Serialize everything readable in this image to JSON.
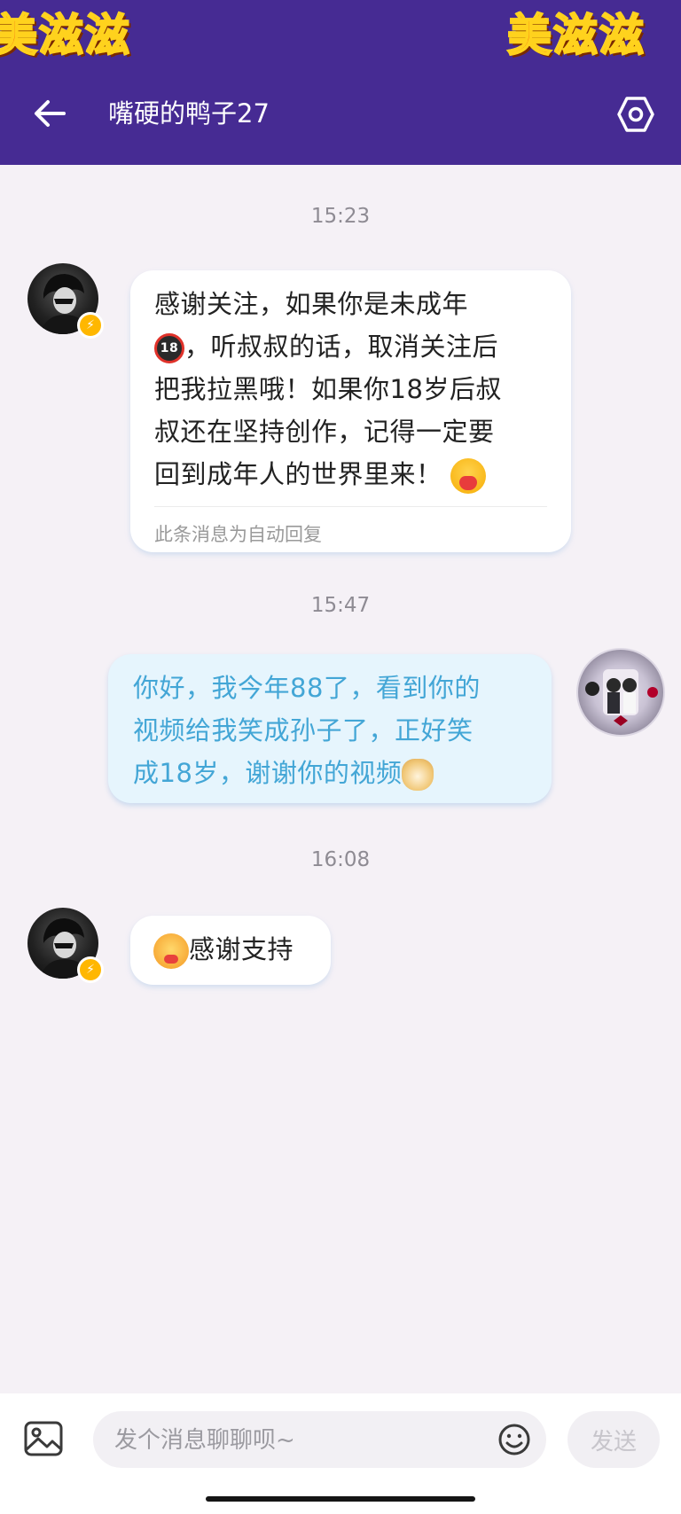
{
  "header": {
    "watermark": "美滋滋",
    "title": "嘴硬的鸭子27",
    "back_icon": "arrow-left-icon",
    "settings_icon": "hexagon-settings-icon",
    "bg_color": "#462b93"
  },
  "messages": [
    {
      "time": "15:23",
      "direction": "incoming",
      "line1": "感谢关注，如果你是未成年",
      "line2": "，听叔叔的话，取消关注后",
      "line3": "把我拉黑哦！如果你18岁后叔",
      "line4": "叔还在坚持创作，记得一定要",
      "line5": "回到成年人的世界里来！",
      "emoji_a": "under-18-icon",
      "emoji_b": "hug-heart-emoji",
      "auto_reply_note": "此条消息为自动回复"
    },
    {
      "time": "15:47",
      "direction": "outgoing",
      "line1": "你好，我今年88了，看到你的",
      "line2": "视频给我笑成孙子了，正好笑",
      "line3": "成18岁，谢谢你的视频",
      "emoji": "doge-emoji",
      "text_color": "#43a6d6"
    },
    {
      "time": "16:08",
      "direction": "incoming",
      "text": "感谢支持",
      "emoji": "blushing-heart-emoji"
    }
  ],
  "composer": {
    "placeholder": "发个消息聊聊呗~",
    "send_label": "发送",
    "image_icon": "image-icon",
    "emoji_icon": "smiley-icon"
  }
}
